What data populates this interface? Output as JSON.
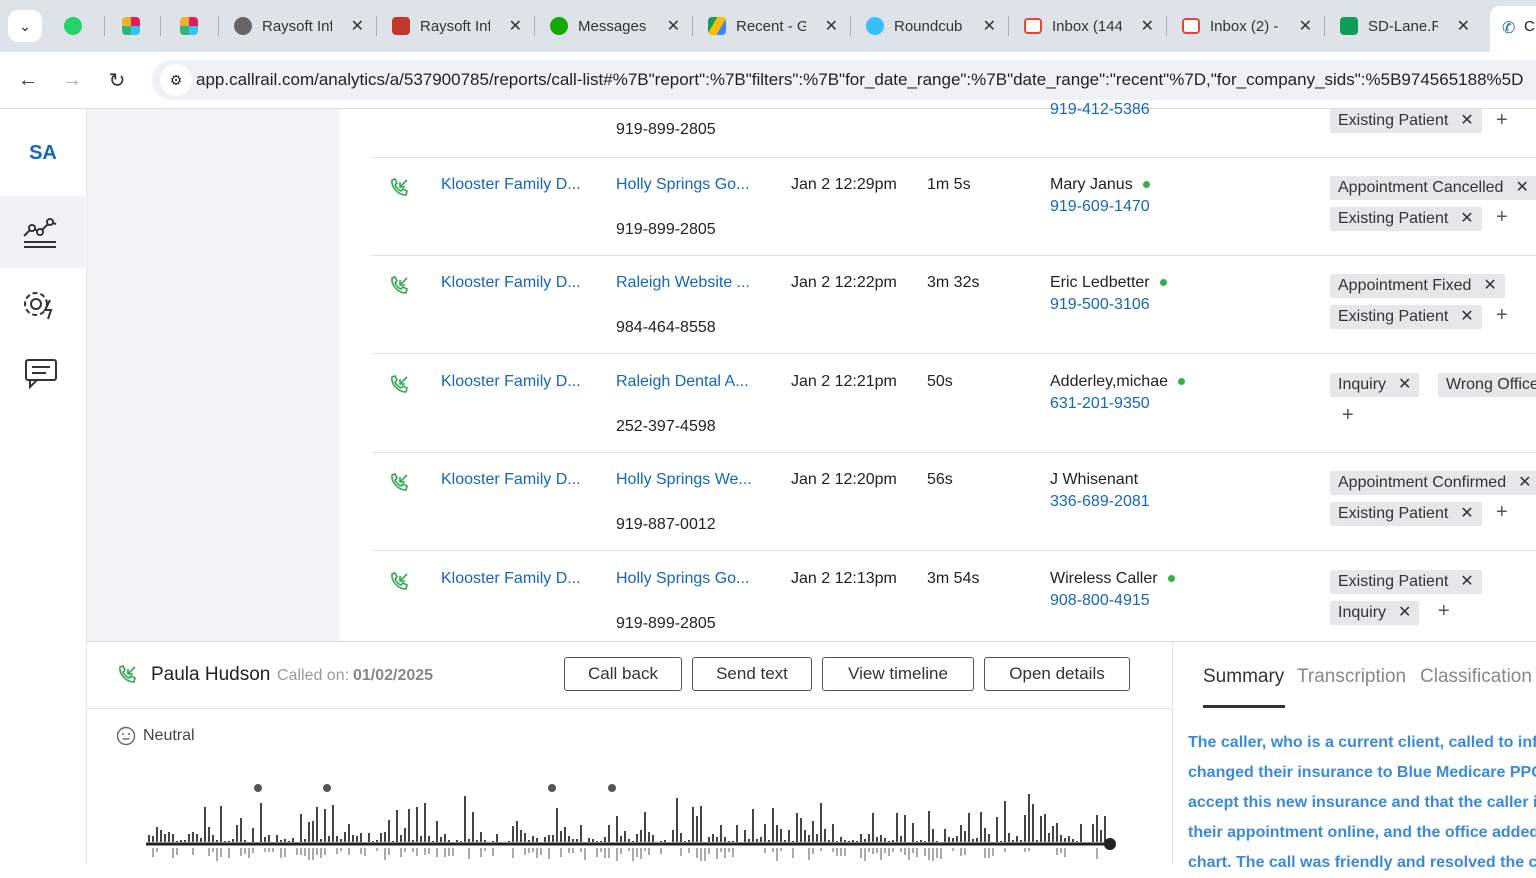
{
  "browser": {
    "tabs": [
      {
        "title": "",
        "icon": "whatsapp-icon",
        "color": "#25d366"
      },
      {
        "title": "",
        "icon": "slack-icon",
        "color": "#e01e5a"
      },
      {
        "title": "",
        "icon": "slack-icon",
        "color": "#36c5f0"
      },
      {
        "title": "Raysoft Inf",
        "icon": "globe-icon",
        "color": "#555555"
      },
      {
        "title": "Raysoft Inf",
        "icon": "raysoft-icon",
        "color": "#c0392b"
      },
      {
        "title": "Messages",
        "icon": "upwork-icon",
        "color": "#14a800"
      },
      {
        "title": "Recent - G",
        "icon": "drive-icon",
        "color": "#fbbc04"
      },
      {
        "title": "Roundcub",
        "icon": "roundcube-icon",
        "color": "#37beff"
      },
      {
        "title": "Inbox (144",
        "icon": "gmail-icon",
        "color": "#ea4335"
      },
      {
        "title": "Inbox (2) -",
        "icon": "gmail-icon",
        "color": "#ea4335"
      },
      {
        "title": "SD-Lane.R",
        "icon": "sheets-icon",
        "color": "#0f9d58"
      }
    ],
    "active_tab_title": "C",
    "url": "app.callrail.com/analytics/a/537900785/reports/call-list#%7B\"report\":%7B\"filters\":%7B\"for_date_range\":%7B\"date_range\":\"recent\"%7D,\"for_company_sids\":%5B974565188%5D"
  },
  "nav": {
    "account": "SA",
    "items": [
      {
        "icon": "analytics-icon"
      },
      {
        "icon": "settings-lightning-icon"
      },
      {
        "icon": "conversations-icon"
      }
    ]
  },
  "calls": {
    "partial_row": {
      "tracking_number": "919-899-2805",
      "caller_number": "919-412-5386",
      "tag": "Existing Patient"
    },
    "rows": [
      {
        "company": "Klooster Family D...",
        "source": "Holly Springs Go...",
        "tracking_number": "919-899-2805",
        "start": "Jan 2 12:29pm",
        "duration": "1m 5s",
        "caller": "Mary Janus",
        "caller_number": "919-609-1470",
        "tags": [
          "Appointment Cancelled",
          "Existing Patient"
        ]
      },
      {
        "company": "Klooster Family D...",
        "source": "Raleigh Website ...",
        "tracking_number": "984-464-8558",
        "start": "Jan 2 12:22pm",
        "duration": "3m 32s",
        "caller": "Eric Ledbetter",
        "caller_number": "919-500-3106",
        "tags": [
          "Appointment Fixed",
          "Existing Patient"
        ]
      },
      {
        "company": "Klooster Family D...",
        "source": "Raleigh Dental A...",
        "tracking_number": "252-397-4598",
        "start": "Jan 2 12:21pm",
        "duration": "50s",
        "caller": "Adderley,michae",
        "caller_number": "631-201-9350",
        "tags": [
          "Inquiry",
          "Wrong Office"
        ]
      },
      {
        "company": "Klooster Family D...",
        "source": "Holly Springs We...",
        "tracking_number": "919-887-0012",
        "start": "Jan 2 12:20pm",
        "duration": "56s",
        "caller": "J Whisenant",
        "caller_number": "336-689-2081",
        "tags": [
          "Appointment Confirmed",
          "Existing Patient"
        ]
      },
      {
        "company": "Klooster Family D...",
        "source": "Holly Springs Go...",
        "tracking_number": "919-899-2805",
        "start": "Jan 2 12:13pm",
        "duration": "3m 54s",
        "caller": "Wireless Caller",
        "caller_number": "908-800-4915",
        "tags": [
          "Existing Patient",
          "Inquiry"
        ]
      }
    ]
  },
  "detail": {
    "caller_name": "Paula Hudson",
    "called_on_label": "Called on:",
    "called_on_date": "01/02/2025",
    "buttons": {
      "call_back": "Call back",
      "send_text": "Send text",
      "view_timeline": "View timeline",
      "open_details": "Open details"
    },
    "sentiment": "Neutral",
    "tabs": {
      "summary": "Summary",
      "transcription": "Transcription",
      "classification": "Classification"
    },
    "summary_lines": [
      "The caller, who is a current client, called to info",
      "changed their insurance to Blue Medicare PPO",
      "accept this new insurance and that the caller is",
      "their appointment online, and the office added",
      "chart. The call was friendly and resolved the ca"
    ]
  },
  "colors": {
    "link": "#1466b8",
    "online_dot": "#34b24a",
    "summary_text": "#3a8ad8",
    "call_icon": "#2fa84f"
  }
}
